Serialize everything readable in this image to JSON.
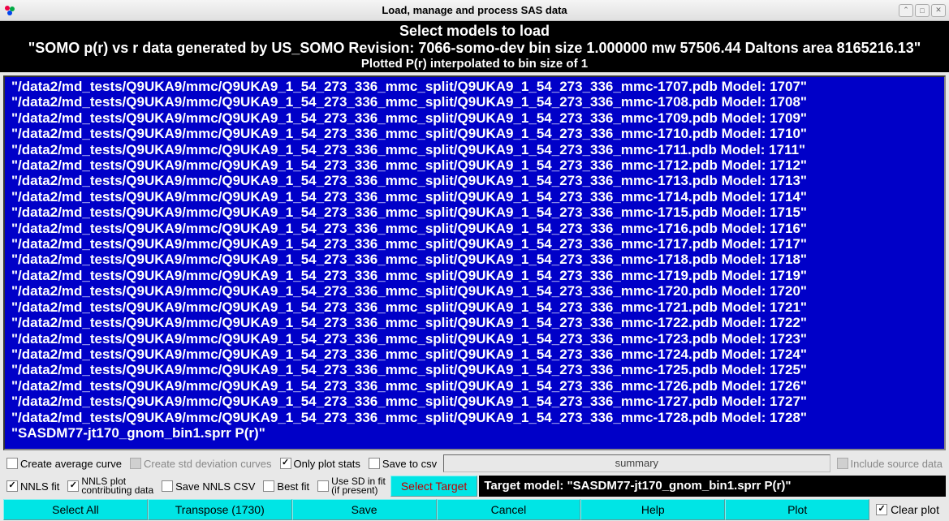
{
  "window": {
    "title": "Load, manage and process SAS data"
  },
  "header": {
    "line1": "Select models to load",
    "line2": "\"SOMO p(r) vs r data generated by US_SOMO  Revision: 7066-somo-dev bin size 1.000000 mw 57506.44 Daltons area 8165216.13\"",
    "line3": "Plotted P(r) interpolated to bin size of 1"
  },
  "models": [
    "\"/data2/md_tests/Q9UKA9/mmc/Q9UKA9_1_54_273_336_mmc_split/Q9UKA9_1_54_273_336_mmc-1707.pdb Model: 1707\"",
    "\"/data2/md_tests/Q9UKA9/mmc/Q9UKA9_1_54_273_336_mmc_split/Q9UKA9_1_54_273_336_mmc-1708.pdb Model: 1708\"",
    "\"/data2/md_tests/Q9UKA9/mmc/Q9UKA9_1_54_273_336_mmc_split/Q9UKA9_1_54_273_336_mmc-1709.pdb Model: 1709\"",
    "\"/data2/md_tests/Q9UKA9/mmc/Q9UKA9_1_54_273_336_mmc_split/Q9UKA9_1_54_273_336_mmc-1710.pdb Model: 1710\"",
    "\"/data2/md_tests/Q9UKA9/mmc/Q9UKA9_1_54_273_336_mmc_split/Q9UKA9_1_54_273_336_mmc-1711.pdb Model: 1711\"",
    "\"/data2/md_tests/Q9UKA9/mmc/Q9UKA9_1_54_273_336_mmc_split/Q9UKA9_1_54_273_336_mmc-1712.pdb Model: 1712\"",
    "\"/data2/md_tests/Q9UKA9/mmc/Q9UKA9_1_54_273_336_mmc_split/Q9UKA9_1_54_273_336_mmc-1713.pdb Model: 1713\"",
    "\"/data2/md_tests/Q9UKA9/mmc/Q9UKA9_1_54_273_336_mmc_split/Q9UKA9_1_54_273_336_mmc-1714.pdb Model: 1714\"",
    "\"/data2/md_tests/Q9UKA9/mmc/Q9UKA9_1_54_273_336_mmc_split/Q9UKA9_1_54_273_336_mmc-1715.pdb Model: 1715\"",
    "\"/data2/md_tests/Q9UKA9/mmc/Q9UKA9_1_54_273_336_mmc_split/Q9UKA9_1_54_273_336_mmc-1716.pdb Model: 1716\"",
    "\"/data2/md_tests/Q9UKA9/mmc/Q9UKA9_1_54_273_336_mmc_split/Q9UKA9_1_54_273_336_mmc-1717.pdb Model: 1717\"",
    "\"/data2/md_tests/Q9UKA9/mmc/Q9UKA9_1_54_273_336_mmc_split/Q9UKA9_1_54_273_336_mmc-1718.pdb Model: 1718\"",
    "\"/data2/md_tests/Q9UKA9/mmc/Q9UKA9_1_54_273_336_mmc_split/Q9UKA9_1_54_273_336_mmc-1719.pdb Model: 1719\"",
    "\"/data2/md_tests/Q9UKA9/mmc/Q9UKA9_1_54_273_336_mmc_split/Q9UKA9_1_54_273_336_mmc-1720.pdb Model: 1720\"",
    "\"/data2/md_tests/Q9UKA9/mmc/Q9UKA9_1_54_273_336_mmc_split/Q9UKA9_1_54_273_336_mmc-1721.pdb Model: 1721\"",
    "\"/data2/md_tests/Q9UKA9/mmc/Q9UKA9_1_54_273_336_mmc_split/Q9UKA9_1_54_273_336_mmc-1722.pdb Model: 1722\"",
    "\"/data2/md_tests/Q9UKA9/mmc/Q9UKA9_1_54_273_336_mmc_split/Q9UKA9_1_54_273_336_mmc-1723.pdb Model: 1723\"",
    "\"/data2/md_tests/Q9UKA9/mmc/Q9UKA9_1_54_273_336_mmc_split/Q9UKA9_1_54_273_336_mmc-1724.pdb Model: 1724\"",
    "\"/data2/md_tests/Q9UKA9/mmc/Q9UKA9_1_54_273_336_mmc_split/Q9UKA9_1_54_273_336_mmc-1725.pdb Model: 1725\"",
    "\"/data2/md_tests/Q9UKA9/mmc/Q9UKA9_1_54_273_336_mmc_split/Q9UKA9_1_54_273_336_mmc-1726.pdb Model: 1726\"",
    "\"/data2/md_tests/Q9UKA9/mmc/Q9UKA9_1_54_273_336_mmc_split/Q9UKA9_1_54_273_336_mmc-1727.pdb Model: 1727\"",
    "\"/data2/md_tests/Q9UKA9/mmc/Q9UKA9_1_54_273_336_mmc_split/Q9UKA9_1_54_273_336_mmc-1728.pdb Model: 1728\"",
    "\"SASDM77-jt170_gnom_bin1.sprr P(r)\""
  ],
  "row1": {
    "create_avg": "Create average curve",
    "create_std": "Create std deviation curves",
    "only_plot": "Only plot stats",
    "save_csv": "Save to csv",
    "summary": "summary",
    "include_src": "Include source data"
  },
  "row2": {
    "nnls_fit": "NNLS fit",
    "nnls_plot_l1": "NNLS plot",
    "nnls_plot_l2": "contributing data",
    "save_nnls_csv": "Save NNLS CSV",
    "best_fit": "Best fit",
    "use_sd_l1": "Use SD in fit",
    "use_sd_l2": "(if present)",
    "select_target": "Select Target",
    "target_label": "Target model: \"SASDM77-jt170_gnom_bin1.sprr P(r)\""
  },
  "buttons": {
    "select_all": "Select All",
    "transpose": "Transpose (1730)",
    "save": "Save",
    "cancel": "Cancel",
    "help": "Help",
    "plot": "Plot",
    "clear_plot": "Clear plot"
  }
}
